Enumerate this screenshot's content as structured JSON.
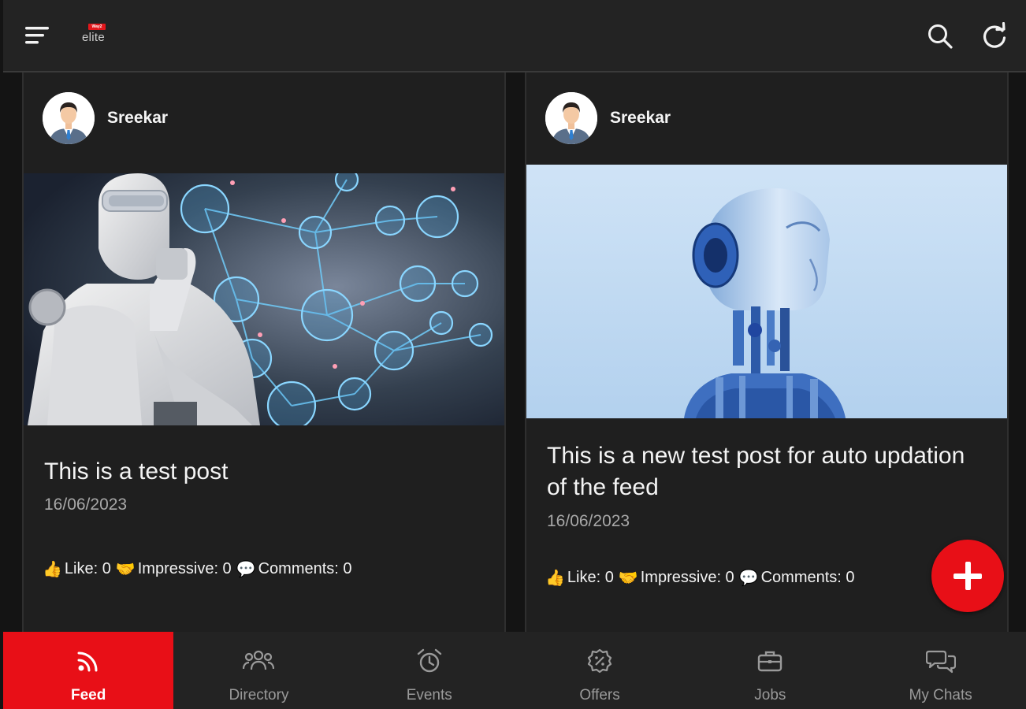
{
  "app": {
    "logo_badge": "Way2",
    "logo_text": "elite"
  },
  "topbar": {
    "menu_icon": "menu-icon",
    "search_icon": "search-icon",
    "refresh_icon": "refresh-icon"
  },
  "posts": [
    {
      "author": "Sreekar",
      "title": "This is a test post",
      "date": "16/06/2023",
      "like_label": "Like: 0",
      "impressive_label": "Impressive: 0",
      "comments_label": "Comments: 0"
    },
    {
      "author": "Sreekar",
      "title": "This is a new test post for auto updation of the feed",
      "date": "16/06/2023",
      "like_label": "Like: 0",
      "impressive_label": "Impressive: 0",
      "comments_label": "Comments: 0"
    }
  ],
  "fab": {
    "icon": "plus-icon"
  },
  "bottom_nav": {
    "items": [
      {
        "label": "Feed",
        "icon": "rss-icon",
        "active": true
      },
      {
        "label": "Directory",
        "icon": "people-icon"
      },
      {
        "label": "Events",
        "icon": "alarm-clock-icon"
      },
      {
        "label": "Offers",
        "icon": "percent-badge-icon"
      },
      {
        "label": "Jobs",
        "icon": "briefcase-icon"
      },
      {
        "label": "My Chats",
        "icon": "chat-bubbles-icon"
      }
    ]
  },
  "colors": {
    "accent": "#e80f17",
    "background": "#141414",
    "card": "#1f1f1f",
    "topbar": "#232323"
  }
}
